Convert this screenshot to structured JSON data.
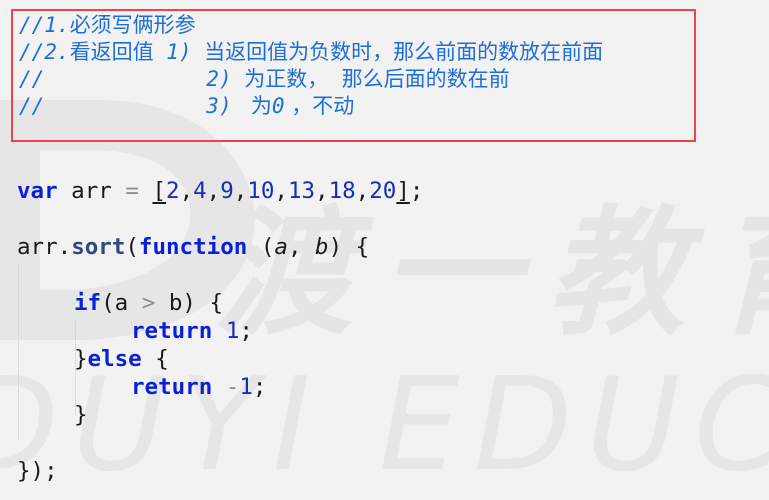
{
  "comment_block": {
    "border_color": "#f0424a",
    "text_color": "#1c6fd8",
    "lines": [
      {
        "prefix": "//1.",
        "text": "必须写俩形参"
      },
      {
        "prefix": "//2.",
        "text": "看返回值",
        "item": " 1) ",
        "desc": "当返回值为负数时，那么前面的数放在前面"
      },
      {
        "prefix": "//",
        "item": "2) ",
        "desc": "为正数，  那么后面的数在前"
      },
      {
        "prefix": "//",
        "item": "3) ",
        "desc_pre": " 为",
        "zero": "0",
        "desc_post": " ，不动"
      }
    ]
  },
  "code": {
    "line1": {
      "kw": "var",
      "name": " arr ",
      "op": "=",
      "space": " ",
      "open": "[",
      "values": [
        "2",
        "4",
        "9",
        "10",
        "13",
        "18",
        "20"
      ],
      "close": "]",
      "semi": ";"
    },
    "line2": {
      "obj": "arr.",
      "method": "sort",
      "paren": "(",
      "kw": "function",
      "params_open": " (",
      "param_a": "a",
      "comma": ", ",
      "param_b": "b",
      "params_close": ") {"
    },
    "line3": {
      "kw": "if",
      "pre": "(a ",
      "op": ">",
      "post": " b) {"
    },
    "line4": {
      "kw": "return",
      "sp": " ",
      "num": "1",
      "semi": ";"
    },
    "line5": {
      "brace": "}",
      "kw": "else",
      "post": " {"
    },
    "line6": {
      "kw": "return",
      "sp": " ",
      "op": "-",
      "num": "1",
      "semi": ";"
    },
    "line7": {
      "brace": "}"
    },
    "line8": {
      "close": "});"
    }
  },
  "watermark": {
    "cn": "渡一教育",
    "en": "DUYI EDUCATION"
  },
  "colors": {
    "background": "#f2f2f2",
    "keyword": "#0a1fd6",
    "number": "#1a2bb8",
    "method": "#2f4a7a",
    "comment": "#1c6fd8"
  }
}
